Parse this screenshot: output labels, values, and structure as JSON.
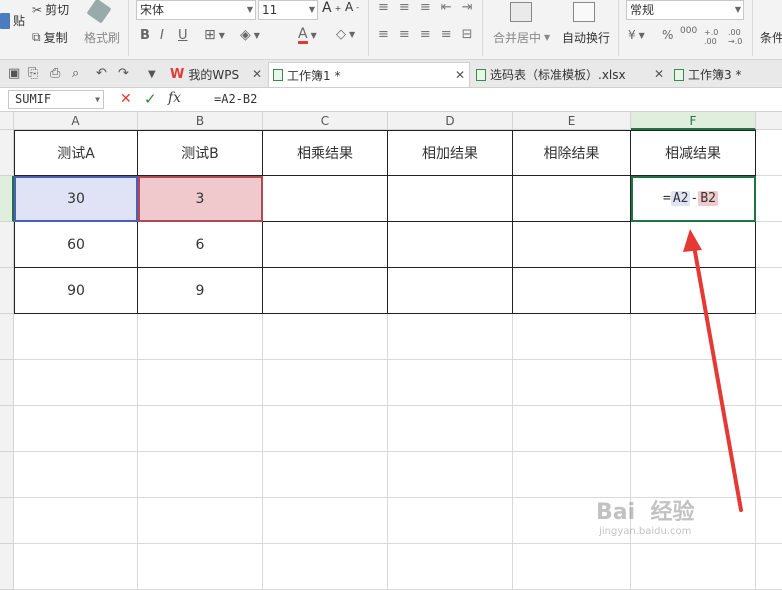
{
  "ribbon": {
    "cut_label": "剪切",
    "paste_label": "贴",
    "copy_label": "复制",
    "format_painter_label": "格式刷",
    "font_name": "宋体",
    "font_size": "11",
    "bold": "B",
    "italic": "I",
    "underline": "U",
    "merge_label": "合并居中",
    "wrap_label": "自动换行",
    "number_format": "常规",
    "conditional_label": "条件",
    "percent": "%",
    "thousands": "000",
    "decimal_inc": "+.0 .00",
    "decimal_dec": ".00 →.0"
  },
  "tabs": [
    {
      "label": "我的WPS",
      "active": false
    },
    {
      "label": "工作簿1 *",
      "active": true
    },
    {
      "label": "选码表（标准模板）.xlsx",
      "active": false
    },
    {
      "label": "工作簿3 *",
      "active": false
    }
  ],
  "formula_bar": {
    "name_box": "SUMIF",
    "cancel": "✕",
    "confirm": "✓",
    "fx": "fx",
    "formula": "=A2-B2"
  },
  "sheet": {
    "columns": [
      "A",
      "B",
      "C",
      "D",
      "E",
      "F"
    ],
    "selected_column": "F",
    "headers": [
      "测试A",
      "测试B",
      "相乘结果",
      "相加结果",
      "相除结果",
      "相减结果"
    ],
    "rows": [
      [
        "30",
        "3",
        "",
        "",
        "",
        ""
      ],
      [
        "60",
        "6",
        "",
        "",
        "",
        ""
      ],
      [
        "90",
        "9",
        "",
        "",
        "",
        ""
      ]
    ],
    "editing_cell_parts": [
      "=",
      "A2",
      "-",
      "B2"
    ]
  },
  "watermark": {
    "brand": "Bai  经验",
    "url": "jingyan.baidu.com"
  },
  "colors": {
    "accent": "#217346",
    "ref_a_fill": "#dfe3f5",
    "ref_b_fill": "#efc9cc",
    "arrow": "#e53935"
  }
}
